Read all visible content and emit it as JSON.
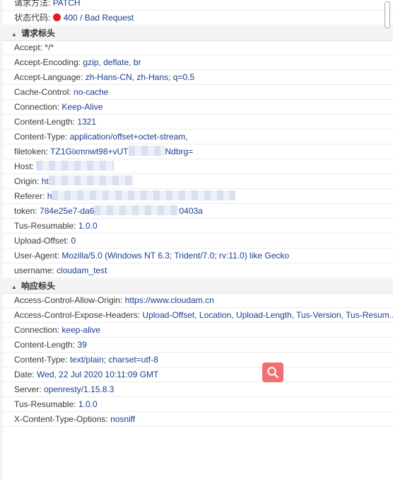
{
  "general": {
    "method_label": "请求方法:",
    "method_value": "PATCH",
    "status_label": "状态代码:",
    "status_value": "400 / Bad Request",
    "status_color": "#e21b1b"
  },
  "request_headers": {
    "title": "请求标头",
    "items": [
      {
        "key": "Accept:",
        "value": "*/*"
      },
      {
        "key": "Accept-Encoding:",
        "value": "gzip, deflate, br"
      },
      {
        "key": "Accept-Language:",
        "value": "zh-Hans-CN, zh-Hans; q=0.5"
      },
      {
        "key": "Cache-Control:",
        "value": "no-cache"
      },
      {
        "key": "Connection:",
        "value": "Keep-Alive"
      },
      {
        "key": "Content-Length:",
        "value": "1321"
      },
      {
        "key": "Content-Type:",
        "value": "application/offset+octet-stream,"
      },
      {
        "key": "filetoken:",
        "value": "TZ1Gixmnwt98+vUT",
        "value_tail": "Ndbrg="
      },
      {
        "key": "Host:",
        "value": ""
      },
      {
        "key": "Origin:",
        "value": "ht"
      },
      {
        "key": "Referer:",
        "value": "h"
      },
      {
        "key": "token:",
        "value": "784e25e7-da6",
        "value_tail": "0403a"
      },
      {
        "key": "Tus-Resumable:",
        "value": "1.0.0"
      },
      {
        "key": "Upload-Offset:",
        "value": "0"
      },
      {
        "key": "User-Agent:",
        "value": "Mozilla/5.0 (Windows NT 6.3; Trident/7.0; rv:11.0) like Gecko"
      },
      {
        "key": "username:",
        "value": "cloudam_test"
      }
    ]
  },
  "response_headers": {
    "title": "响应标头",
    "items": [
      {
        "key": "Access-Control-Allow-Origin:",
        "value": "https://www.cloudam.cn"
      },
      {
        "key": "Access-Control-Expose-Headers:",
        "value": "Upload-Offset, Location, Upload-Length, Tus-Version, Tus-Resum..."
      },
      {
        "key": "Connection:",
        "value": "keep-alive"
      },
      {
        "key": "Content-Length:",
        "value": "39"
      },
      {
        "key": "Content-Type:",
        "value": "text/plain; charset=utf-8"
      },
      {
        "key": "Date:",
        "value": "Wed, 22 Jul 2020 10:11:09 GMT"
      },
      {
        "key": "Server:",
        "value": "openresty/1.15.8.3"
      },
      {
        "key": "Tus-Resumable:",
        "value": "1.0.0"
      },
      {
        "key": "X-Content-Type-Options:",
        "value": "nosniff"
      }
    ]
  },
  "search_button_color": "#f07072",
  "search_icon": "search-icon"
}
